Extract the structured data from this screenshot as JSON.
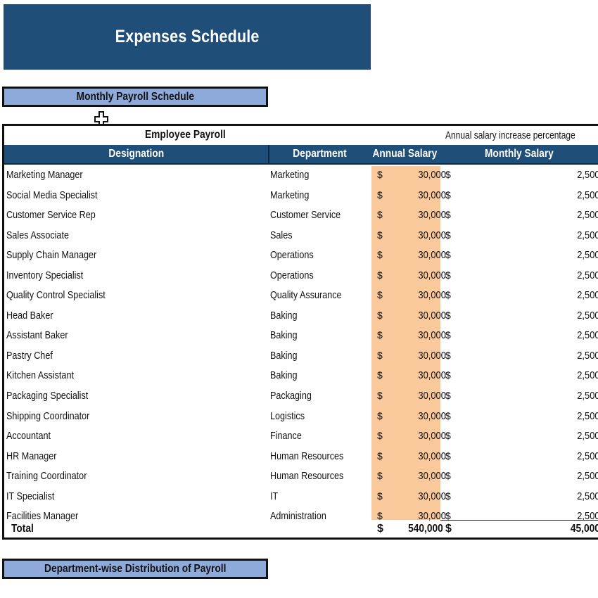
{
  "page": {
    "title": "Expenses Schedule"
  },
  "sections": {
    "monthly_payroll": "Monthly Payroll Schedule",
    "department_distribution": "Department-wise Distribution of Payroll"
  },
  "payroll_table": {
    "title": "Employee Payroll",
    "note": "Annual salary increase percentage",
    "columns": {
      "designation": "Designation",
      "department": "Department",
      "annual_salary": "Annual Salary",
      "monthly_salary": "Monthly Salary"
    },
    "currency_symbol": "$",
    "highlight_color": "#f9c89b",
    "header_color": "#1f4e79",
    "rows": [
      {
        "designation": "Marketing Manager",
        "department": "Marketing",
        "annual": "30,000",
        "monthly": "2,500"
      },
      {
        "designation": "Social Media Specialist",
        "department": "Marketing",
        "annual": "30,000",
        "monthly": "2,500"
      },
      {
        "designation": "Customer Service Rep",
        "department": "Customer Service",
        "annual": "30,000",
        "monthly": "2,500"
      },
      {
        "designation": "Sales Associate",
        "department": "Sales",
        "annual": "30,000",
        "monthly": "2,500"
      },
      {
        "designation": "Supply Chain Manager",
        "department": "Operations",
        "annual": "30,000",
        "monthly": "2,500"
      },
      {
        "designation": "Inventory Specialist",
        "department": "Operations",
        "annual": "30,000",
        "monthly": "2,500"
      },
      {
        "designation": "Quality Control Specialist",
        "department": "Quality Assurance",
        "annual": "30,000",
        "monthly": "2,500"
      },
      {
        "designation": "Head Baker",
        "department": "Baking",
        "annual": "30,000",
        "monthly": "2,500"
      },
      {
        "designation": "Assistant Baker",
        "department": "Baking",
        "annual": "30,000",
        "monthly": "2,500"
      },
      {
        "designation": "Pastry Chef",
        "department": "Baking",
        "annual": "30,000",
        "monthly": "2,500"
      },
      {
        "designation": "Kitchen Assistant",
        "department": "Baking",
        "annual": "30,000",
        "monthly": "2,500"
      },
      {
        "designation": "Packaging Specialist",
        "department": "Packaging",
        "annual": "30,000",
        "monthly": "2,500"
      },
      {
        "designation": "Shipping Coordinator",
        "department": "Logistics",
        "annual": "30,000",
        "monthly": "2,500"
      },
      {
        "designation": "Accountant",
        "department": "Finance",
        "annual": "30,000",
        "monthly": "2,500"
      },
      {
        "designation": "HR Manager",
        "department": "Human Resources",
        "annual": "30,000",
        "monthly": "2,500"
      },
      {
        "designation": "Training Coordinator",
        "department": "Human Resources",
        "annual": "30,000",
        "monthly": "2,500"
      },
      {
        "designation": "IT Specialist",
        "department": "IT",
        "annual": "30,000",
        "monthly": "2,500"
      },
      {
        "designation": "Facilities Manager",
        "department": "Administration",
        "annual": "30,000",
        "monthly": "2,500"
      }
    ],
    "total": {
      "label": "Total",
      "annual": "540,000",
      "monthly": "45,000"
    }
  }
}
